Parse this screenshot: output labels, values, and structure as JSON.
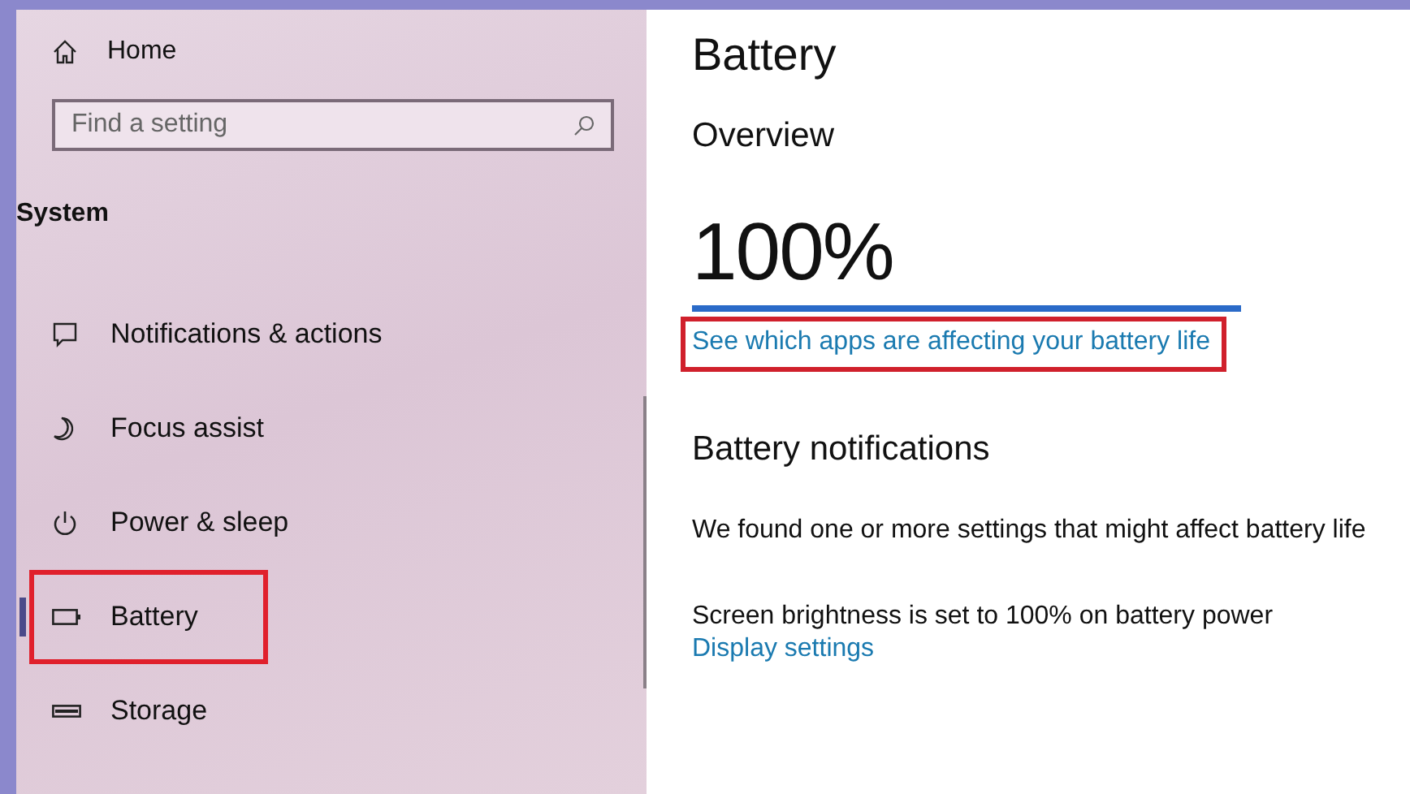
{
  "sidebar": {
    "home": "Home",
    "search": {
      "placeholder": "Find a setting"
    },
    "section": "System",
    "items": [
      {
        "label": "Notifications & actions",
        "selected": false,
        "highlighted": false
      },
      {
        "label": "Focus assist",
        "selected": false,
        "highlighted": false
      },
      {
        "label": "Power & sleep",
        "selected": false,
        "highlighted": false
      },
      {
        "label": "Battery",
        "selected": true,
        "highlighted": true
      },
      {
        "label": "Storage",
        "selected": false,
        "highlighted": false
      }
    ]
  },
  "content": {
    "title": "Battery",
    "overview": {
      "heading": "Overview",
      "percent": "100%",
      "link": {
        "text": "See which apps are affecting your battery life",
        "highlighted": true
      }
    },
    "notifications": {
      "heading": "Battery notifications",
      "message": "We found one or more settings that might affect battery life",
      "detail": "Screen brightness is set to 100% on battery power",
      "link": "Display settings"
    }
  }
}
